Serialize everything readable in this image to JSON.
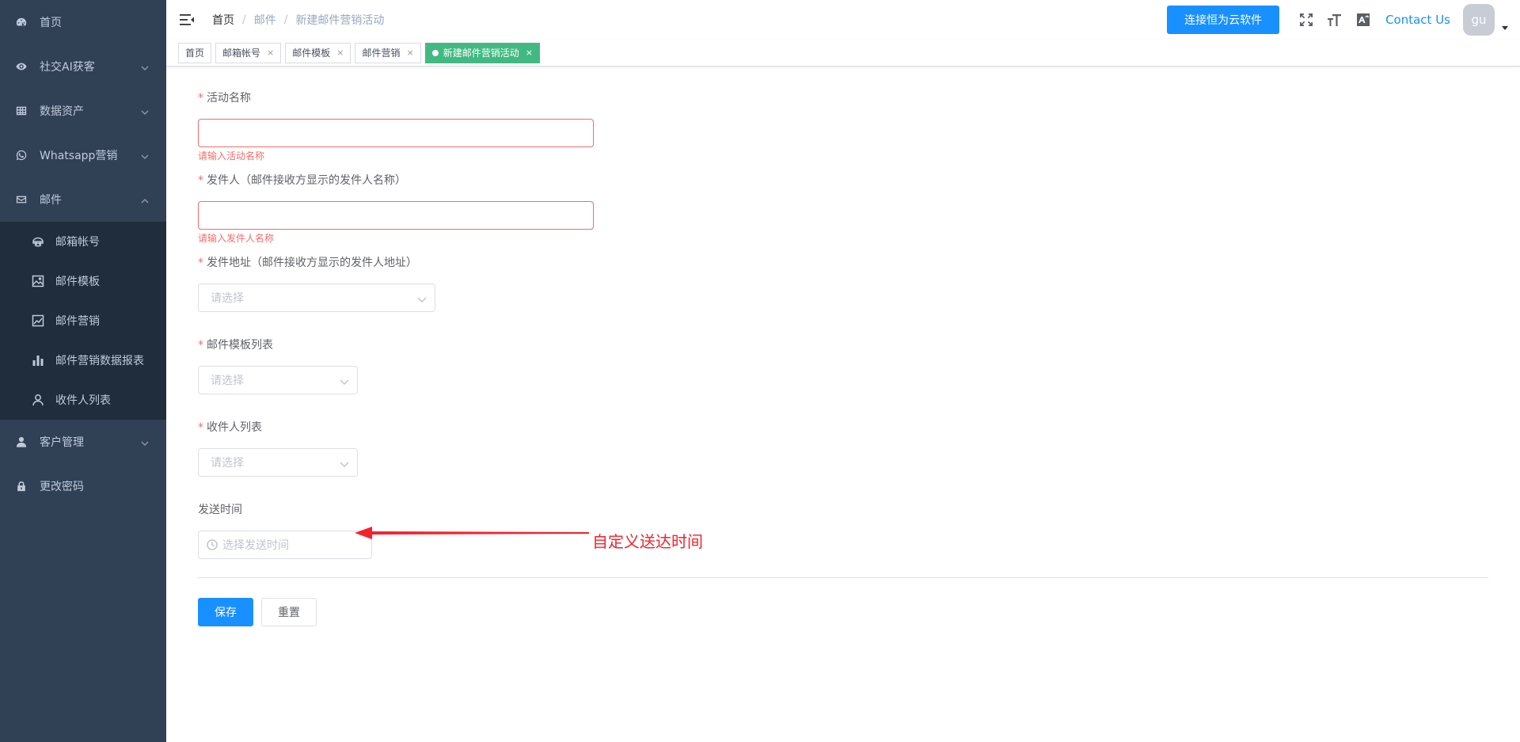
{
  "sidebar": {
    "items": [
      {
        "label": "首页",
        "icon": "dashboard-icon",
        "has_arrow": false
      },
      {
        "label": "社交AI获客",
        "icon": "eye-icon",
        "has_arrow": true
      },
      {
        "label": "数据资产",
        "icon": "table-icon",
        "has_arrow": true
      },
      {
        "label": "Whatsapp营销",
        "icon": "whatsapp-icon",
        "has_arrow": true
      },
      {
        "label": "邮件",
        "icon": "mail-icon",
        "has_arrow": true,
        "expanded": true
      }
    ],
    "mail_submenu": [
      {
        "label": "邮箱帐号",
        "icon": "mailbox-icon"
      },
      {
        "label": "邮件模板",
        "icon": "image-icon"
      },
      {
        "label": "邮件营销",
        "icon": "chart-line-icon"
      },
      {
        "label": "邮件营销数据报表",
        "icon": "bar-chart-icon"
      },
      {
        "label": "收件人列表",
        "icon": "user-icon"
      }
    ],
    "bottom_items": [
      {
        "label": "客户管理",
        "icon": "person-icon",
        "has_arrow": true
      },
      {
        "label": "更改密码",
        "icon": "lock-icon",
        "has_arrow": false
      }
    ]
  },
  "header": {
    "breadcrumb": [
      "首页",
      "邮件",
      "新建邮件营销活动"
    ],
    "connect_button": "连接恒为云软件",
    "contact_link": "Contact Us",
    "avatar_text": "gu"
  },
  "tags": [
    {
      "label": "首页",
      "closable": false,
      "active": false
    },
    {
      "label": "邮箱帐号",
      "closable": true,
      "active": false
    },
    {
      "label": "邮件模板",
      "closable": true,
      "active": false
    },
    {
      "label": "邮件营销",
      "closable": true,
      "active": false
    },
    {
      "label": "新建邮件营销活动",
      "closable": true,
      "active": true
    }
  ],
  "tag_close_glyph": "×",
  "form": {
    "campaign_name": {
      "label": "活动名称",
      "required": true,
      "value": "",
      "error": "请输入活动名称"
    },
    "sender_name": {
      "label": "发件人（邮件接收方显示的发件人名称）",
      "required": true,
      "value": "",
      "error": "请输入发件人名称"
    },
    "sender_address": {
      "label": "发件地址（邮件接收方显示的发件人地址）",
      "required": true,
      "placeholder": "请选择"
    },
    "template_list": {
      "label": "邮件模板列表",
      "required": true,
      "placeholder": "请选择"
    },
    "recipient_list": {
      "label": "收件人列表",
      "required": true,
      "placeholder": "请选择"
    },
    "send_time": {
      "label": "发送时间",
      "required": false,
      "placeholder": "选择发送时间"
    },
    "required_mark": "*",
    "save_label": "保存",
    "reset_label": "重置"
  },
  "annotation": {
    "text": "自定义送达时间",
    "color": "#f5222d"
  },
  "colors": {
    "sidebar_bg": "#304156",
    "submenu_bg": "#1f2d3d",
    "primary": "#1890ff",
    "active_tag": "#42b983",
    "error": "#f56c6c"
  }
}
